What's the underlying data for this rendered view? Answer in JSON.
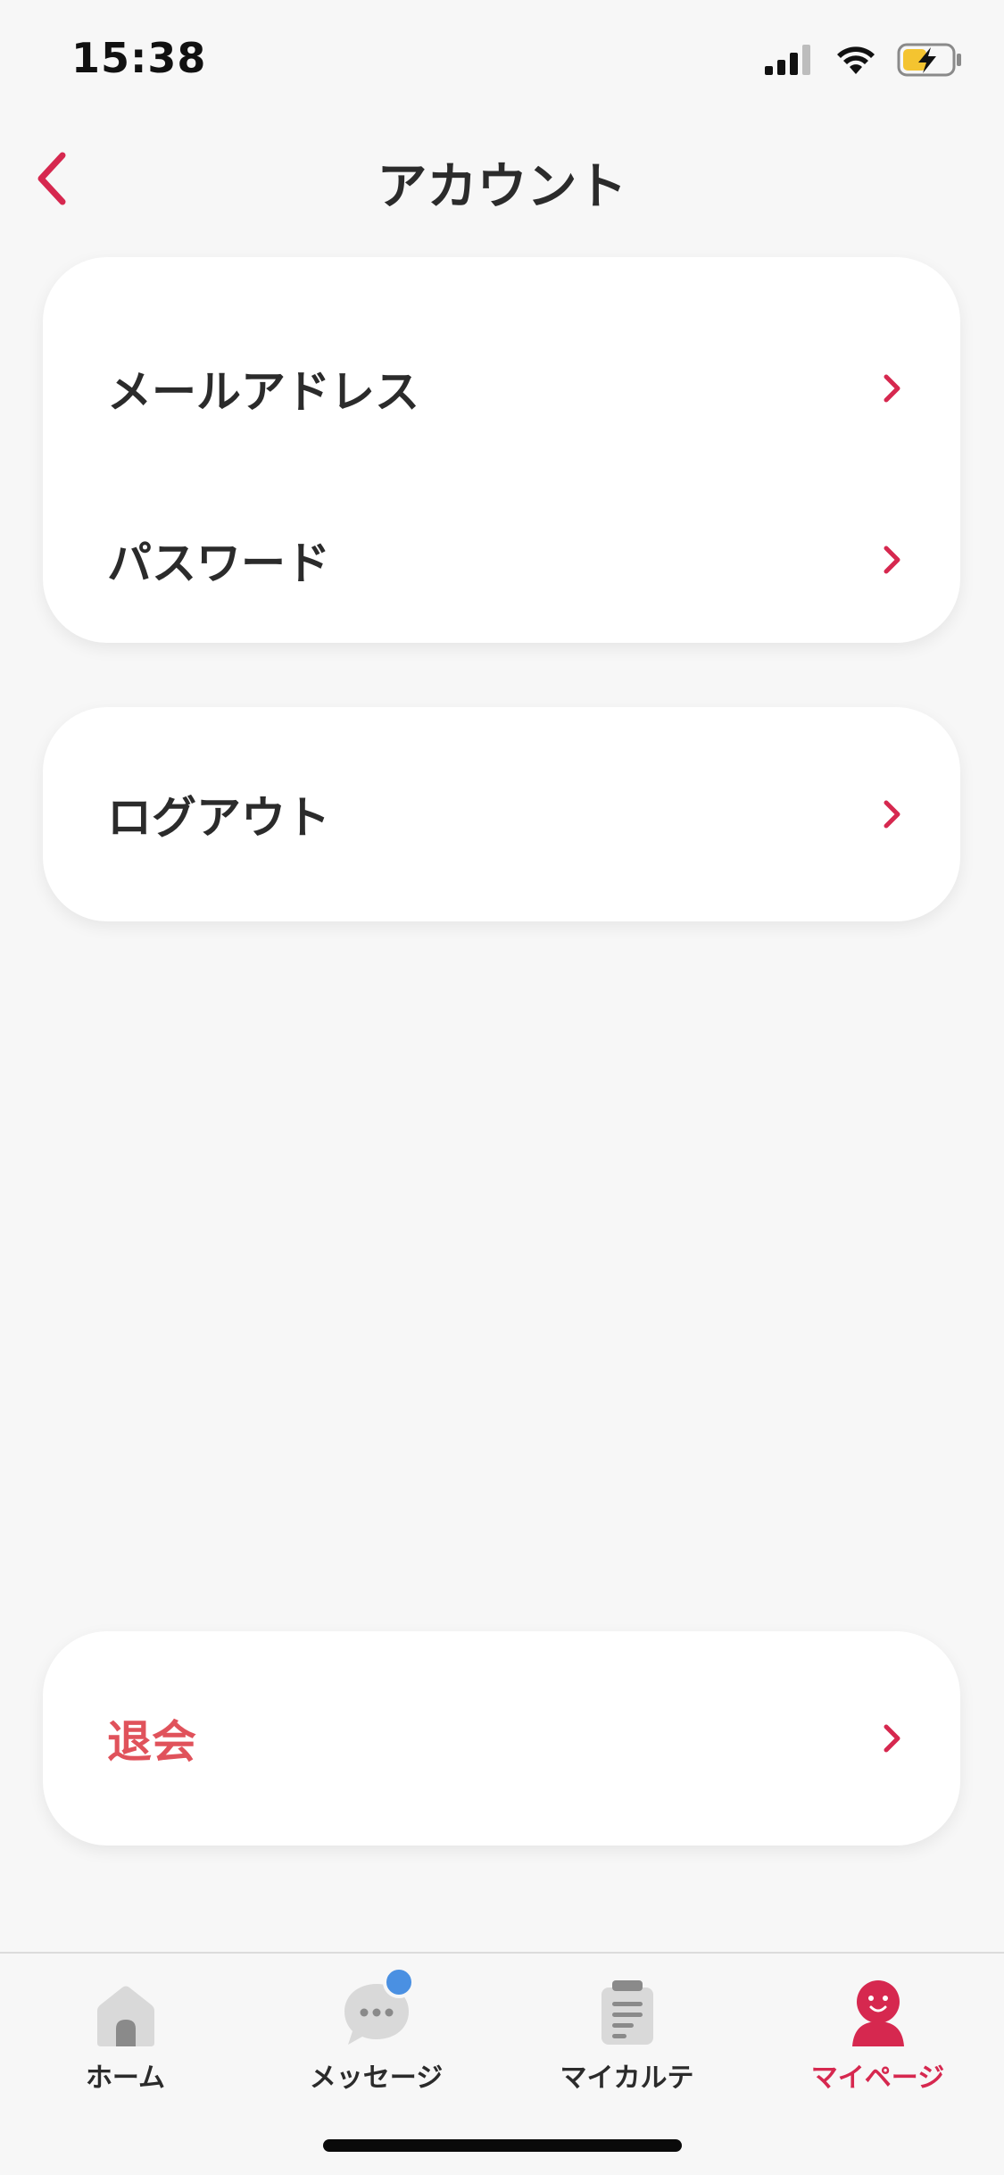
{
  "status_bar": {
    "time": "15:38",
    "icons": [
      "signal-icon",
      "wifi-icon",
      "battery-charging-icon"
    ]
  },
  "nav": {
    "title": "アカウント",
    "back_icon": "chevron-left-icon"
  },
  "sections": [
    {
      "items": [
        {
          "label": "メールアドレス"
        },
        {
          "label": "パスワード"
        }
      ]
    },
    {
      "items": [
        {
          "label": "ログアウト"
        }
      ]
    },
    {
      "items": [
        {
          "label": "退会",
          "style": "danger"
        }
      ]
    }
  ],
  "tabs": [
    {
      "label": "ホーム",
      "icon": "home-icon"
    },
    {
      "label": "メッセージ",
      "icon": "message-bubble-icon",
      "badge": true
    },
    {
      "label": "マイカルテ",
      "icon": "clipboard-icon"
    },
    {
      "label": "マイページ",
      "icon": "person-icon",
      "active": true
    }
  ],
  "colors": {
    "accent": "#d6284f",
    "danger_text": "#e0525b",
    "background": "#f7f7f7",
    "card": "#ffffff",
    "badge": "#4a90e2"
  }
}
